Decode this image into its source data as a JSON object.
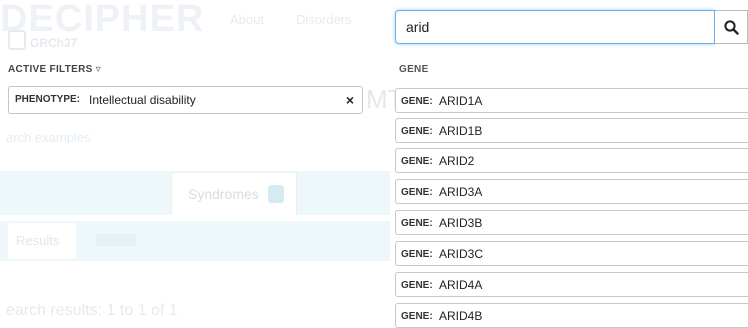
{
  "app": {
    "logo": "DECIPHER",
    "assembly": "GRCh37",
    "nav": [
      "About",
      "Disorders"
    ]
  },
  "filters": {
    "label": "ACTIVE FILTERS",
    "chip": {
      "key": "PHENOTYPE:",
      "value": "Intellectual disability",
      "remove": "×"
    }
  },
  "background": {
    "mt_text": "MT",
    "examples_link": "arch examples",
    "tabs": {
      "syndromes_label": "Syndromes"
    },
    "results_button": "Results",
    "search_results_text": "earch results: 1 to 1 of 1"
  },
  "search": {
    "value": "arid",
    "button_icon": "search-icon"
  },
  "dropdown": {
    "header": "GENE",
    "items": [
      {
        "key": "GENE:",
        "value": "ARID1A"
      },
      {
        "key": "GENE:",
        "value": "ARID1B"
      },
      {
        "key": "GENE:",
        "value": "ARID2"
      },
      {
        "key": "GENE:",
        "value": "ARID3A"
      },
      {
        "key": "GENE:",
        "value": "ARID3B"
      },
      {
        "key": "GENE:",
        "value": "ARID3C"
      },
      {
        "key": "GENE:",
        "value": "ARID4A"
      },
      {
        "key": "GENE:",
        "value": "ARID4B"
      }
    ]
  }
}
